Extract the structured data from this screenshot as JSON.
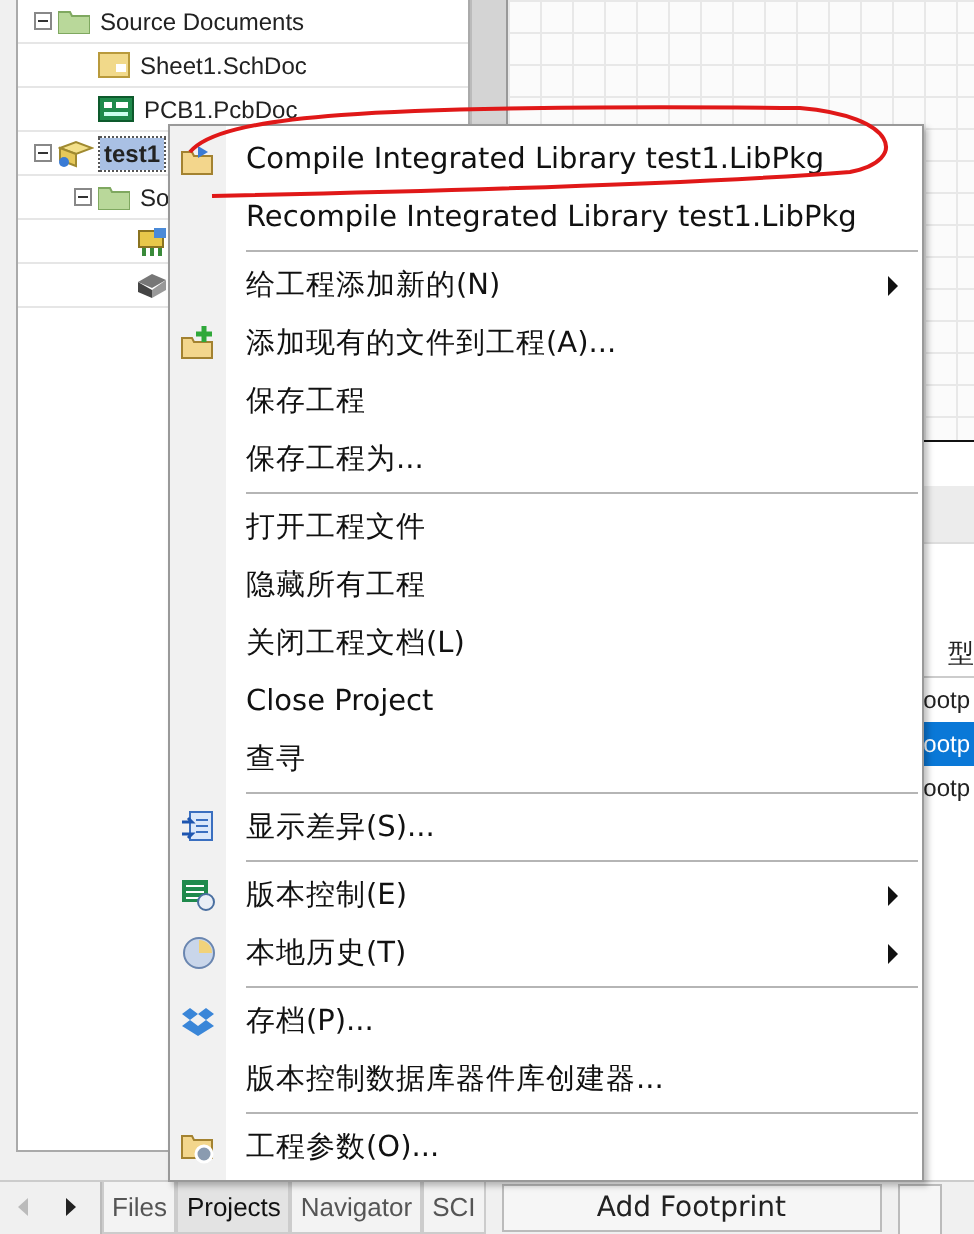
{
  "tree": [
    {
      "children": [
        {
          "label": "Source Documents",
          "kind": "folder",
          "expanded": true,
          "selected": false,
          "children": [
            {
              "label": "Sheet1.SchDoc",
              "kind": "sch",
              "selected": false
            },
            {
              "label": "PCB1.PcbDoc",
              "kind": "pcb",
              "selected": false
            }
          ]
        }
      ]
    },
    {
      "label": "test1",
      "kind": "project",
      "expanded": true,
      "selected": true,
      "children": [
        {
          "label": "So",
          "kind": "folder",
          "expanded": true,
          "selected": false,
          "children": [
            {
              "kind": "schlib"
            },
            {
              "kind": "pcblib"
            }
          ]
        }
      ]
    }
  ],
  "table": {
    "columns": [
      "型"
    ],
    "rows": [
      {
        "cells": [
          "ootp"
        ],
        "selected": false
      },
      {
        "cells": [
          "ootp"
        ],
        "selected": true
      },
      {
        "cells": [
          "ootp"
        ],
        "selected": false
      }
    ]
  },
  "menu": [
    {
      "kind": "item",
      "label": "Compile Integrated Library test1.LibPkg"
    },
    {
      "kind": "item",
      "label": "Recompile Integrated Library test1.LibPkg"
    },
    {
      "kind": "separator"
    },
    {
      "kind": "item",
      "label": "给工程添加新的(N)",
      "submenu": true
    },
    {
      "kind": "item",
      "label": "添加现有的文件到工程(A)..."
    },
    {
      "kind": "item",
      "label": "保存工程"
    },
    {
      "kind": "item",
      "label": "保存工程为..."
    },
    {
      "kind": "separator"
    },
    {
      "kind": "item",
      "label": "打开工程文件"
    },
    {
      "kind": "item",
      "label": "隐藏所有工程"
    },
    {
      "kind": "item",
      "label": "关闭工程文档(L)"
    },
    {
      "kind": "item",
      "label": "Close Project"
    },
    {
      "kind": "item",
      "label": "查寻"
    },
    {
      "kind": "separator"
    },
    {
      "kind": "item",
      "label": "显示差异(S)..."
    },
    {
      "kind": "separator"
    },
    {
      "kind": "item",
      "label": "版本控制(E)",
      "submenu": true
    },
    {
      "kind": "item",
      "label": "本地历史(T)",
      "submenu": true
    },
    {
      "kind": "separator"
    },
    {
      "kind": "item",
      "label": "存档(P)..."
    },
    {
      "kind": "item",
      "label": "版本控制数据库器件库创建器..."
    },
    {
      "kind": "separator"
    },
    {
      "kind": "item",
      "label": "工程参数(O)..."
    }
  ],
  "tabs": [
    {
      "label": "Files",
      "selected": false
    },
    {
      "label": "Projects",
      "selected": true
    },
    {
      "label": "Navigator",
      "selected": false
    },
    {
      "label": "SCI",
      "selected": false
    }
  ],
  "buttons": [
    "Add Footprint"
  ]
}
